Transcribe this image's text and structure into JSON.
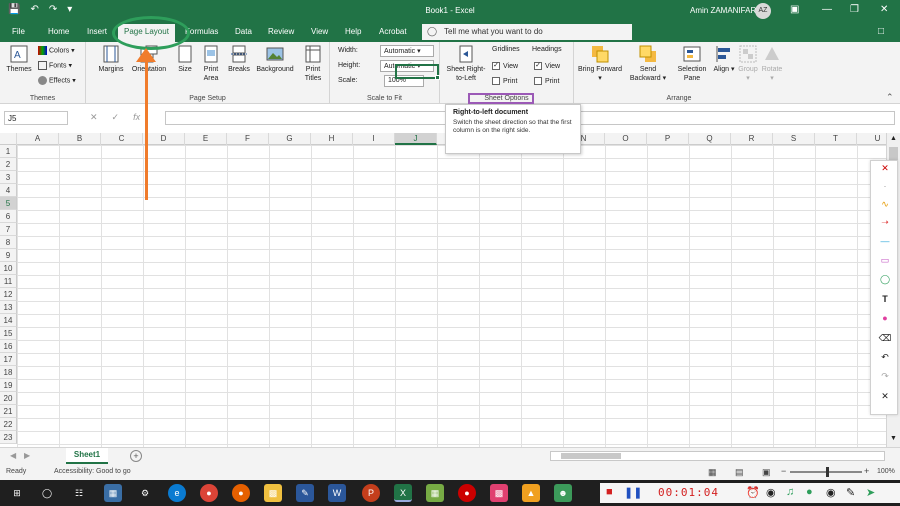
{
  "titlebar": {
    "title": "Book1 - Excel",
    "user_name": "Amin ZAMANIFAR",
    "avatar_initials": "AZ"
  },
  "tabs": [
    {
      "label": "File"
    },
    {
      "label": "Home"
    },
    {
      "label": "Insert"
    },
    {
      "label": "Page Layout"
    },
    {
      "label": "Formulas"
    },
    {
      "label": "Data"
    },
    {
      "label": "Review"
    },
    {
      "label": "View"
    },
    {
      "label": "Help"
    },
    {
      "label": "Acrobat"
    }
  ],
  "active_tab": "Page Layout",
  "tell_me": {
    "placeholder": "Tell me what you want to do"
  },
  "ribbon": {
    "themes": {
      "themes": "Themes",
      "colors": "Colors",
      "fonts": "Fonts",
      "effects": "Effects",
      "group": "Themes"
    },
    "page_setup": {
      "margins": "Margins",
      "orientation": "Orientation",
      "size": "Size",
      "print_area": "Print Area",
      "breaks": "Breaks",
      "background": "Background",
      "print_titles": "Print Titles",
      "group": "Page Setup"
    },
    "scale_to_fit": {
      "width_label": "Width:",
      "width_value": "Automatic",
      "height_label": "Height:",
      "height_value": "Automatic",
      "scale_label": "Scale:",
      "scale_value": "100%",
      "group": "Scale to Fit"
    },
    "sheet_options": {
      "rtl": "Sheet Right-to-Left",
      "gridlines": "Gridlines",
      "headings": "Headings",
      "view": "View",
      "print": "Print",
      "group": "Sheet Options"
    },
    "arrange": {
      "bring_forward": "Bring Forward",
      "send_backward": "Send Backward",
      "selection_pane": "Selection Pane",
      "align": "Align",
      "group_btn": "Group",
      "rotate": "Rotate",
      "group": "Arrange"
    }
  },
  "tooltip": {
    "title": "Right-to-left document",
    "body": "Switch the sheet direction so that the first column is on the right side."
  },
  "formula_bar": {
    "name_box": "J5",
    "formula": ""
  },
  "columns": [
    "A",
    "B",
    "C",
    "D",
    "E",
    "F",
    "G",
    "H",
    "I",
    "J",
    "K",
    "L",
    "M",
    "N",
    "O",
    "P",
    "Q",
    "R",
    "S",
    "T",
    "U"
  ],
  "rows": [
    "1",
    "2",
    "3",
    "4",
    "5",
    "6",
    "7",
    "8",
    "9",
    "10",
    "11",
    "12",
    "13",
    "14",
    "15",
    "16",
    "17",
    "18",
    "19",
    "20",
    "21",
    "22",
    "23"
  ],
  "selected_cell": {
    "column": "J",
    "row": "5"
  },
  "sheets": [
    {
      "name": "Sheet1"
    }
  ],
  "statusbar": {
    "ready": "Ready",
    "accessibility": "Accessibility: Good to go",
    "zoom": "100%"
  },
  "recorder": {
    "timer": "00:01:04"
  },
  "colors": {
    "excel_green": "#217346",
    "annotation_circle": "#2e9e5b",
    "annotation_arrow": "#f07c2c",
    "highlight_box": "#9b59b6"
  }
}
